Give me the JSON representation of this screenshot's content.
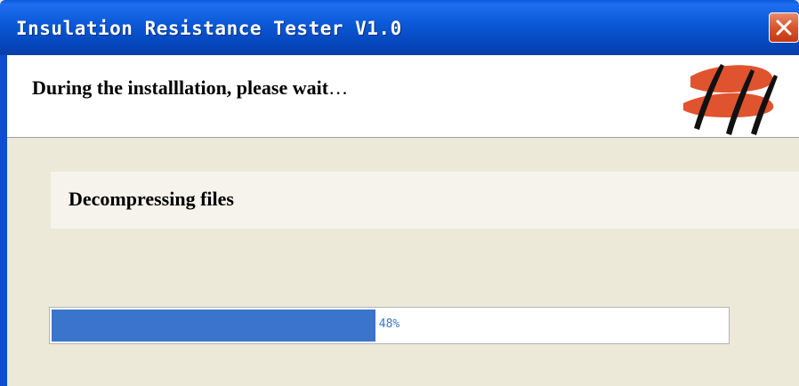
{
  "window": {
    "title": "Insulation Resistance Tester V1.0",
    "colors": {
      "titlebar": "#0a58d6",
      "body": "#ece9d8",
      "progress_fill": "#3b74cc",
      "logo_stroke": "#e0532f"
    }
  },
  "header": {
    "title": "During the installlation, please wait",
    "ellipsis": "…",
    "logo_icon": "logo-icon"
  },
  "status": {
    "text": "Decompressing files"
  },
  "progress": {
    "percent_label": "48%",
    "fraction": 0.48
  },
  "controls": {
    "close_icon": "close-icon"
  }
}
